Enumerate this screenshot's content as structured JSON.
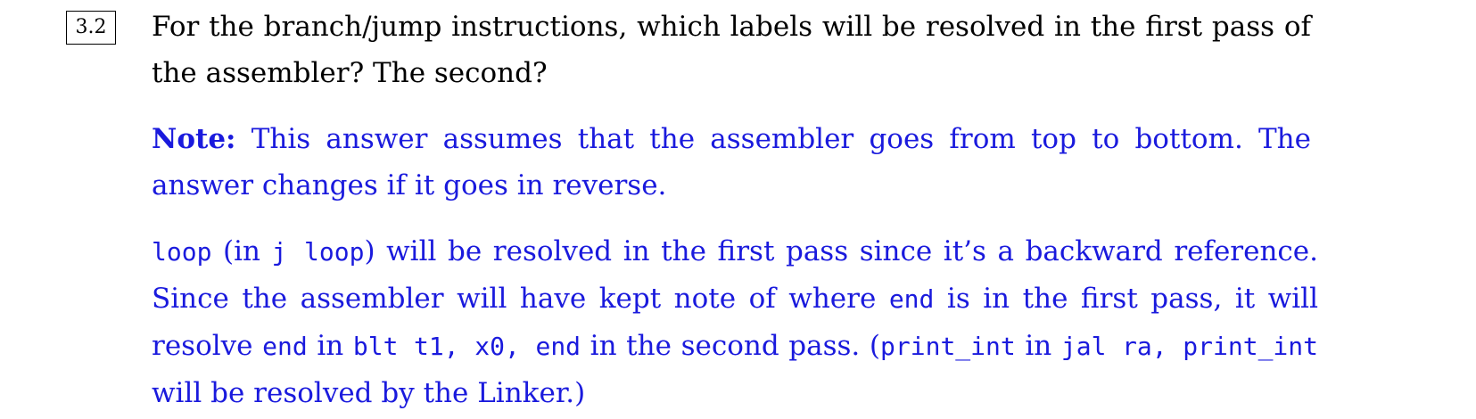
{
  "question": {
    "number": "3.2",
    "text": "For the branch/jump instructions, which labels will be resolved in the first pass of the assembler? The second?"
  },
  "answer": {
    "note_label": "Note:",
    "note_text": "This answer assumes that the assembler goes from top to bottom. The answer changes if it goes in reverse.",
    "explanation": {
      "code_loop": "loop",
      "t1": " (in ",
      "code_j_loop": "j loop",
      "t2": ") will be resolved in the first pass since it’s a backward reference. Since the assembler will have kept note of where ",
      "code_end_1": "end",
      "t3": " is in the first pass, it will resolve ",
      "code_end_2": "end",
      "t4": " in ",
      "code_blt": "blt t1, x0, end",
      "t5": " in the second pass. (",
      "code_print_int_1": "print_int",
      "t6": " in ",
      "code_jal": "jal ra, print_int",
      "t7": " will be resolved by the Linker.)"
    }
  }
}
